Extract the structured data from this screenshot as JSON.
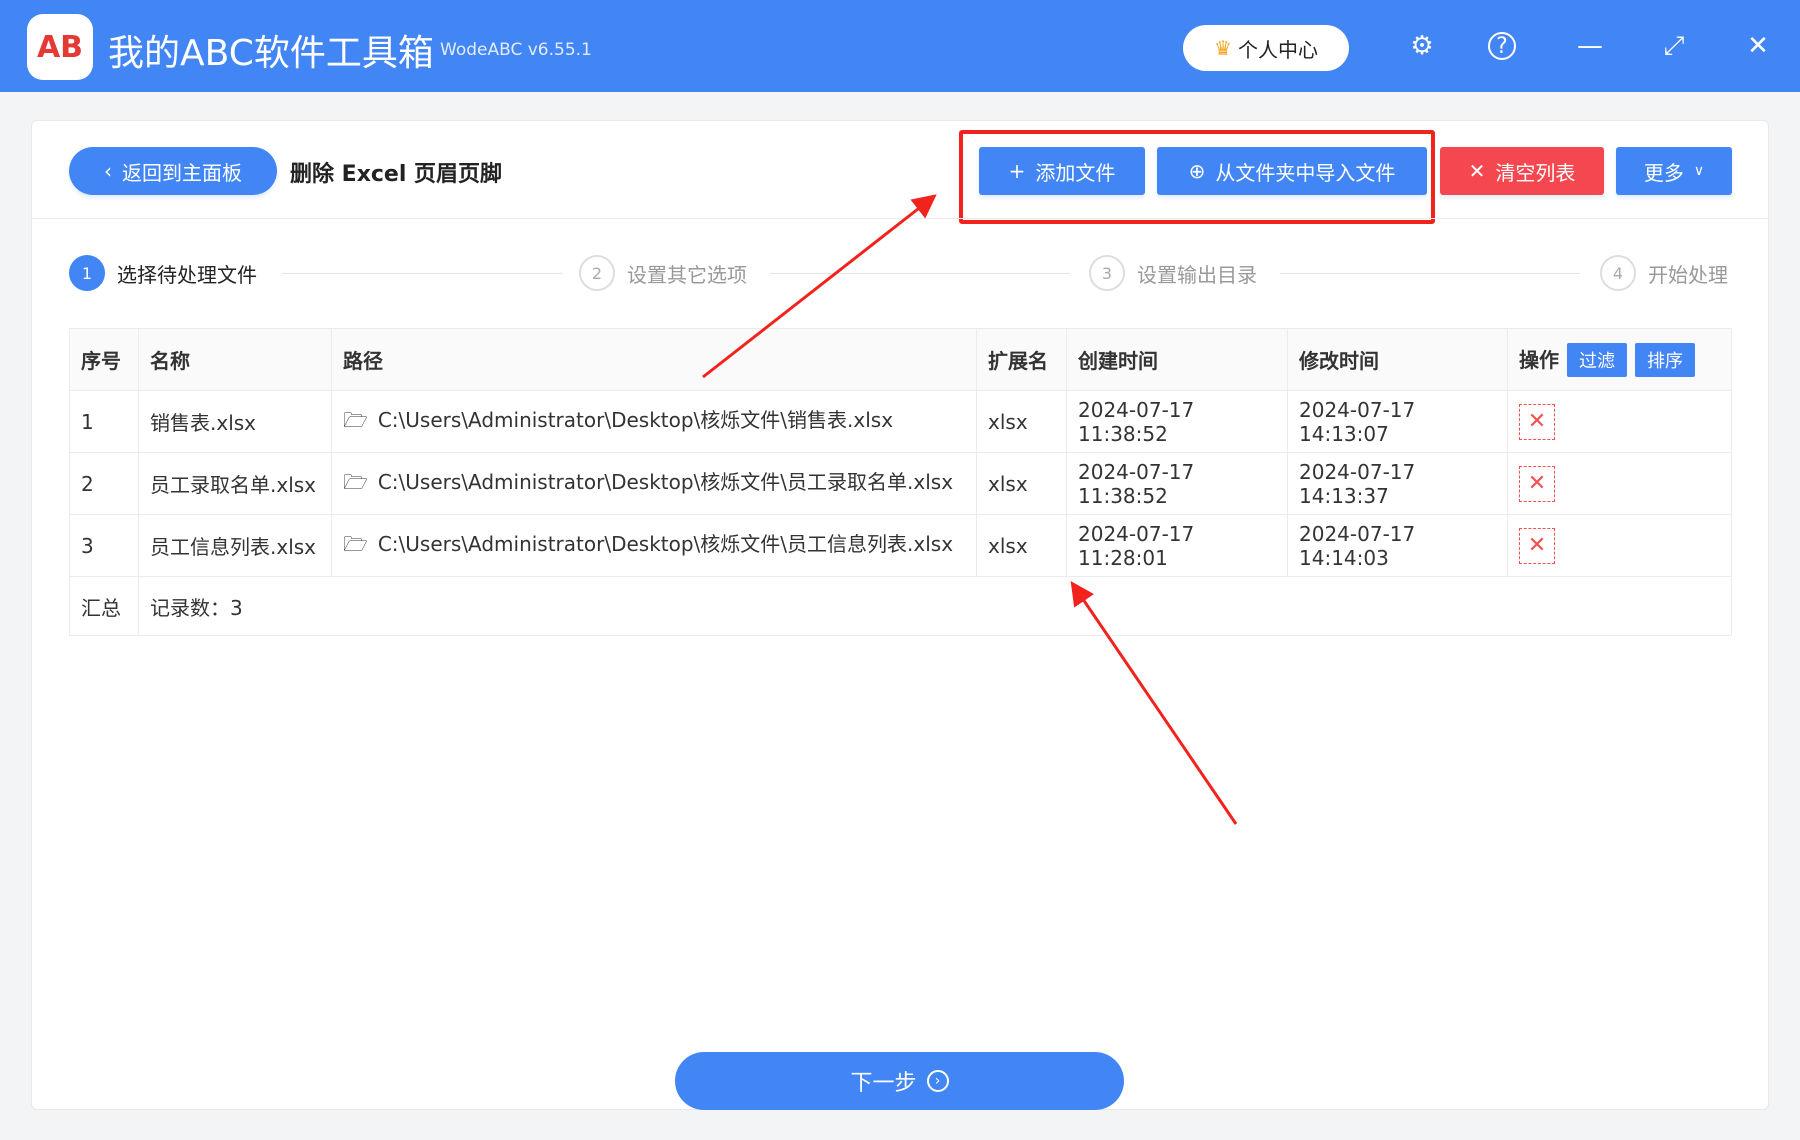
{
  "app": {
    "logo_text": "AB",
    "title": "我的ABC软件工具箱",
    "version": "WodeABC v6.55.1",
    "user_center": "个人中心"
  },
  "toolbar": {
    "back": "返回到主面板",
    "page_title": "删除 Excel 页眉页脚",
    "add_file": "添加文件",
    "import_folder": "从文件夹中导入文件",
    "clear_list": "清空列表",
    "more": "更多"
  },
  "steps": [
    {
      "num": "1",
      "label": "选择待处理文件"
    },
    {
      "num": "2",
      "label": "设置其它选项"
    },
    {
      "num": "3",
      "label": "设置输出目录"
    },
    {
      "num": "4",
      "label": "开始处理"
    }
  ],
  "table": {
    "headers": [
      "序号",
      "名称",
      "路径",
      "扩展名",
      "创建时间",
      "修改时间",
      "操作"
    ],
    "filter": "过滤",
    "sort": "排序",
    "rows": [
      [
        "1",
        "销售表.xlsx",
        "C:\\Users\\Administrator\\Desktop\\核烁文件\\销售表.xlsx",
        "xlsx",
        "2024-07-17 11:38:52",
        "2024-07-17 14:13:07"
      ],
      [
        "2",
        "员工录取名单.xlsx",
        "C:\\Users\\Administrator\\Desktop\\核烁文件\\员工录取名单.xlsx",
        "xlsx",
        "2024-07-17 11:38:52",
        "2024-07-17 14:13:37"
      ],
      [
        "3",
        "员工信息列表.xlsx",
        "C:\\Users\\Administrator\\Desktop\\核烁文件\\员工信息列表.xlsx",
        "xlsx",
        "2024-07-17 11:28:01",
        "2024-07-17 14:14:03"
      ]
    ],
    "summary_label": "汇总",
    "summary_value": "记录数：3"
  },
  "next": "下一步"
}
